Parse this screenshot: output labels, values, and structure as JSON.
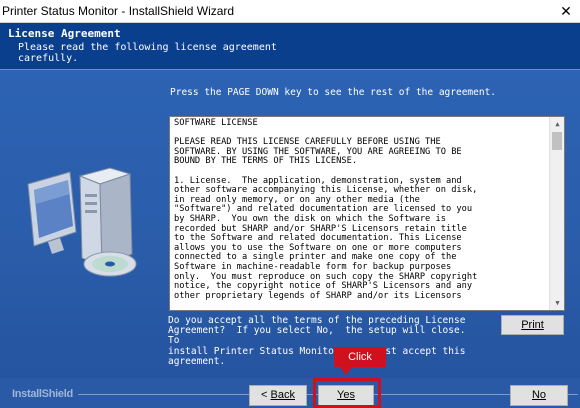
{
  "window": {
    "title": "Printer Status Monitor - InstallShield Wizard",
    "close_glyph": "✕"
  },
  "header": {
    "title": "License Agreement",
    "subtitle": "Please read the following license agreement carefully."
  },
  "main": {
    "instruction": "Press the PAGE DOWN key to see the rest of the agreement.",
    "license_text": "SOFTWARE LICENSE\n\nPLEASE READ THIS LICENSE CAREFULLY BEFORE USING THE\nSOFTWARE. BY USING THE SOFTWARE, YOU ARE AGREEING TO BE\nBOUND BY THE TERMS OF THIS LICENSE.\n\n1. License.  The application, demonstration, system and\nother software accompanying this License, whether on disk,\nin read only memory, or on any other media (the\n\"Software\") and related documentation are licensed to you\nby SHARP.  You own the disk on which the Software is\nrecorded but SHARP and/or SHARP'S Licensors retain title\nto the Software and related documentation. This License\nallows you to use the Software on one or more computers\nconnected to a single printer and make one copy of the\nSoftware in machine-readable form for backup purposes\nonly.  You must reproduce on such copy the SHARP copyright\nnotice, the copyright notice of SHARP'S Licensors and any\nother proprietary legends of SHARP and/or its Licensors",
    "question": "Do you accept all the terms of the preceding License\nAgreement?  If you select No,  the setup will close.  To\ninstall Printer Status Monitor, you must accept this\nagreement.",
    "print_label": "Print",
    "scroll_up_glyph": "▲",
    "scroll_down_glyph": "▼"
  },
  "footer": {
    "brand": "InstallShield",
    "back_prefix": "< ",
    "back_label": "Back",
    "yes_label": "Yes",
    "no_label": "No"
  },
  "annotation": {
    "callout_text": "Click",
    "color": "#d0101c"
  },
  "colors": {
    "header_bg": "#0a3f8e",
    "body_bg": "#2a5aa6"
  }
}
